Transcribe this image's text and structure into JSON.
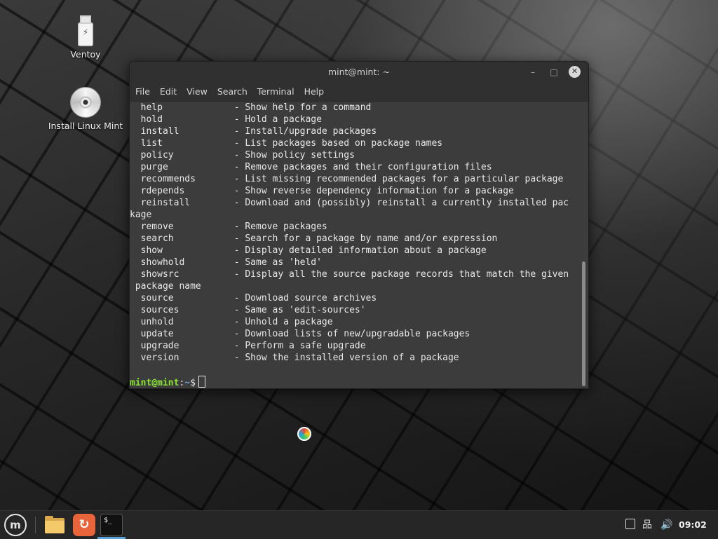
{
  "desktop": {
    "icons": [
      {
        "label": "Ventoy",
        "icon": "usb-drive-icon"
      },
      {
        "label": "Install Linux Mint",
        "icon": "disc-icon"
      }
    ]
  },
  "window": {
    "title": "mint@mint: ~",
    "controls": {
      "minimize": "–",
      "maximize": "□",
      "close": "✕"
    },
    "menu": [
      "File",
      "Edit",
      "View",
      "Search",
      "Terminal",
      "Help"
    ]
  },
  "terminal": {
    "lines": [
      "  help             - Show help for a command",
      "  hold             - Hold a package",
      "  install          - Install/upgrade packages",
      "  list             - List packages based on package names",
      "  policy           - Show policy settings",
      "  purge            - Remove packages and their configuration files",
      "  recommends       - List missing recommended packages for a particular package",
      "  rdepends         - Show reverse dependency information for a package",
      "  reinstall        - Download and (possibly) reinstall a currently installed pac",
      "kage",
      "  remove           - Remove packages",
      "  search           - Search for a package by name and/or expression",
      "  show             - Display detailed information about a package",
      "  showhold         - Same as 'held'",
      "  showsrc          - Display all the source package records that match the given",
      " package name",
      "  source           - Download source archives",
      "  sources          - Same as 'edit-sources'",
      "  unhold           - Unhold a package",
      "  update           - Download lists of new/upgradable packages",
      "  upgrade          - Perform a safe upgrade",
      "  version          - Show the installed version of a package"
    ],
    "prompt": {
      "user": "mint@mint",
      "separator": ":",
      "path": "~",
      "symbol": "$"
    }
  },
  "taskbar": {
    "menu_logo": "m",
    "apps": [
      {
        "name": "files",
        "icon": "folder-icon"
      },
      {
        "name": "update-manager",
        "icon": "update-manager-icon",
        "glyph": "↻"
      },
      {
        "name": "terminal",
        "icon": "terminal-icon",
        "glyph": "$_"
      }
    ],
    "tray": {
      "volume_glyph": "🔊",
      "network_glyph": "品"
    },
    "clock": "09:02"
  },
  "colors": {
    "prompt_user": "#8ae234",
    "prompt_path": "#729fcf",
    "terminal_bg": "#3c3c3c",
    "active_indicator": "#5ba4d9"
  }
}
